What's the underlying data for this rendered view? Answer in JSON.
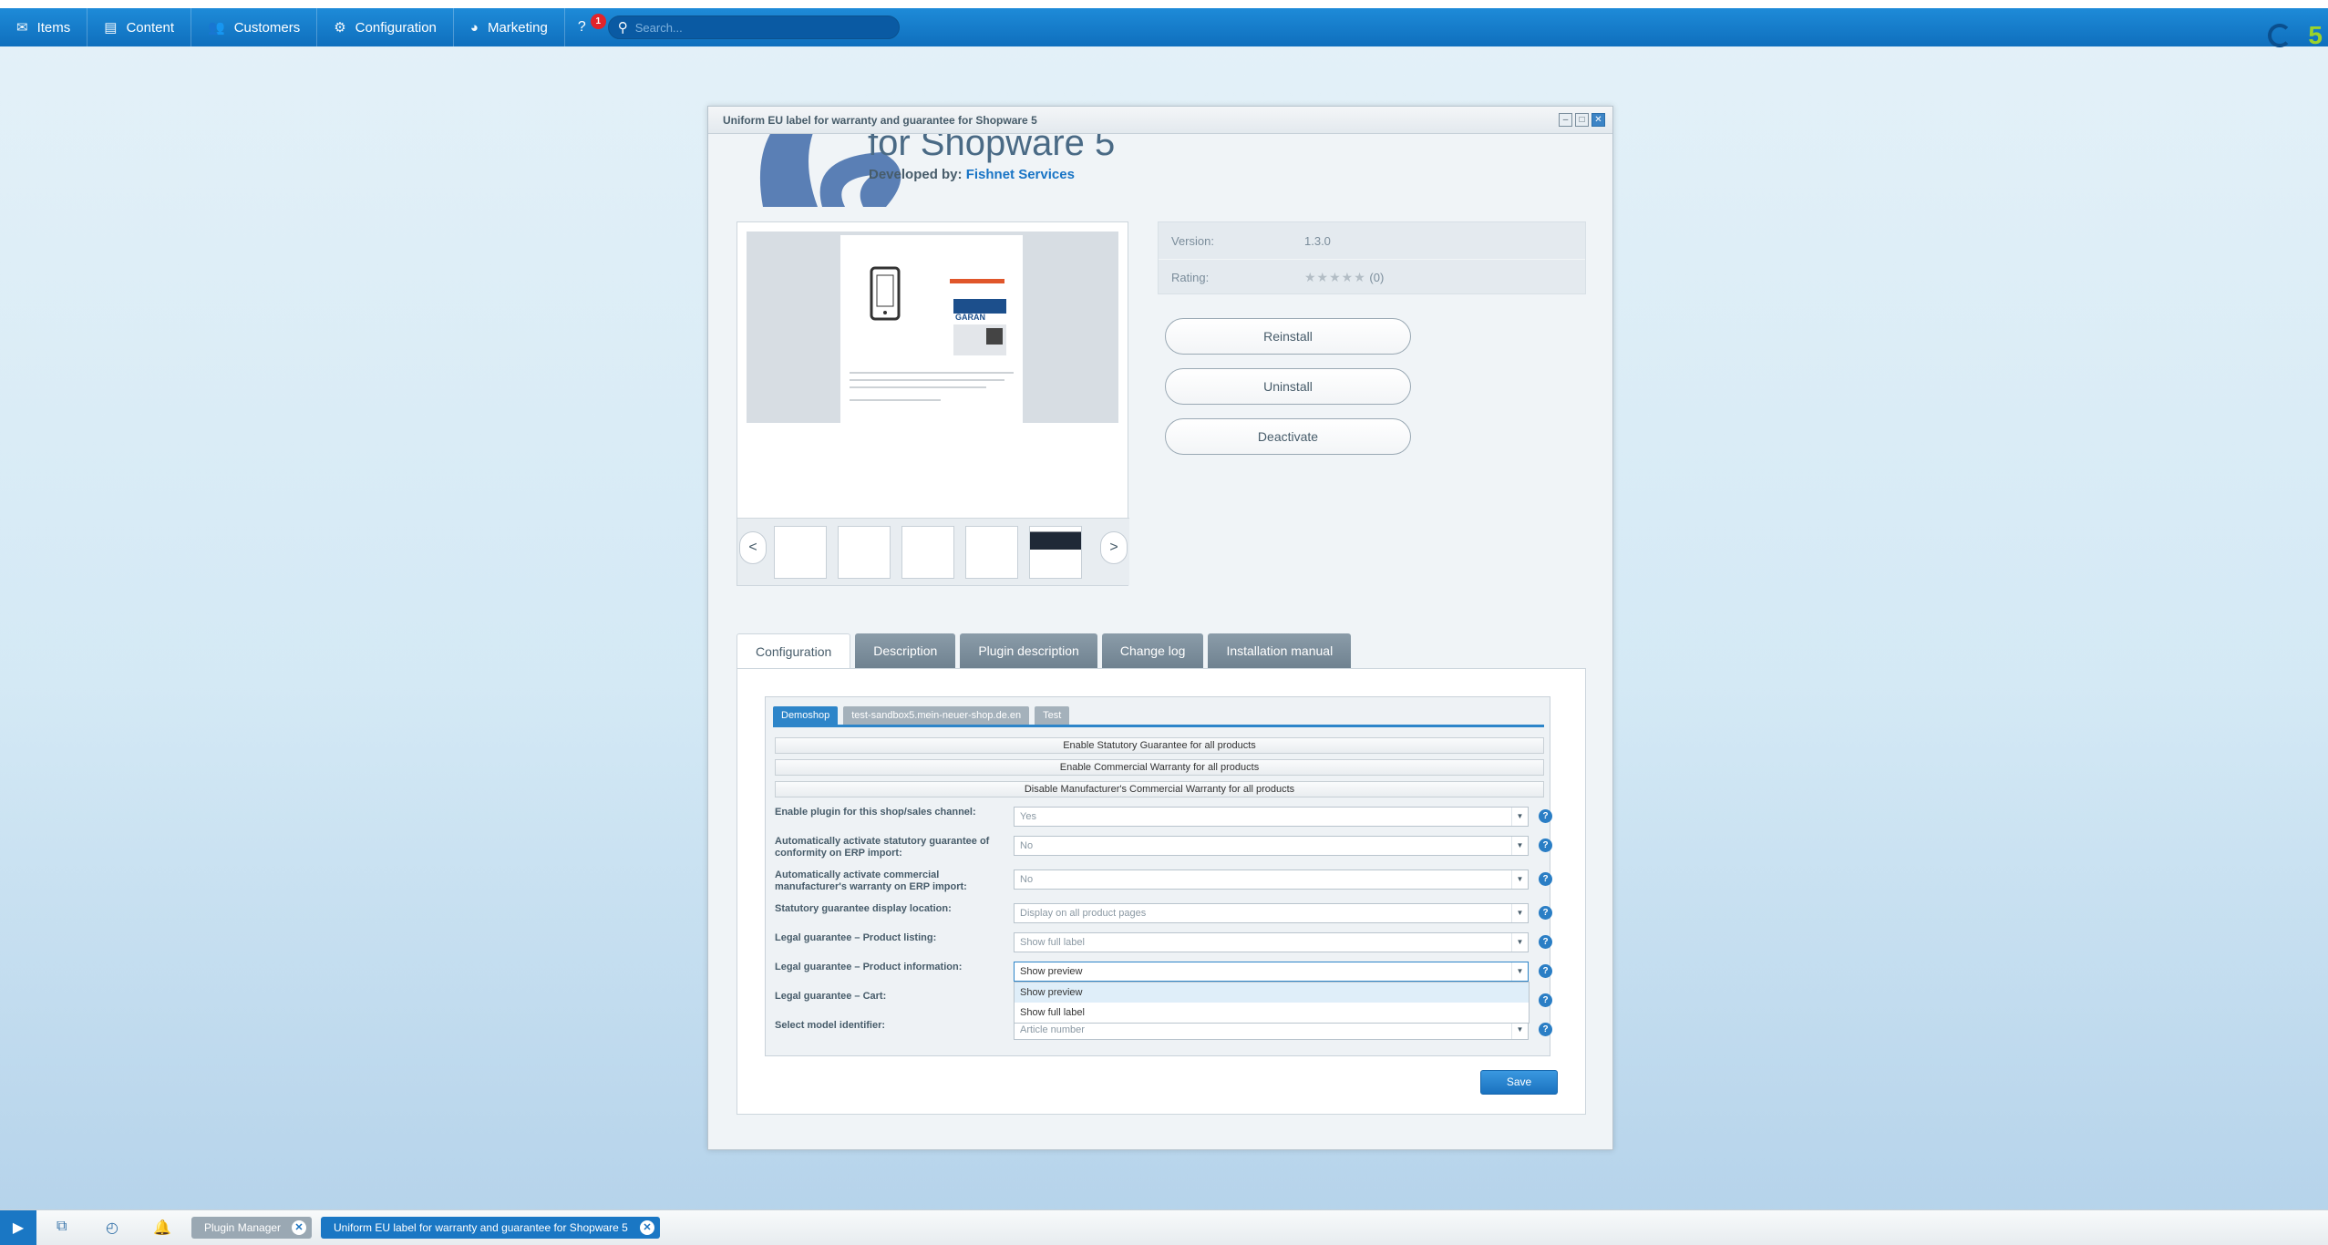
{
  "topbar": {
    "menu": [
      {
        "label": "Items",
        "icon": "items-icon"
      },
      {
        "label": "Content",
        "icon": "content-icon"
      },
      {
        "label": "Customers",
        "icon": "customers-icon"
      },
      {
        "label": "Configuration",
        "icon": "gear-icon"
      },
      {
        "label": "Marketing",
        "icon": "marketing-icon"
      }
    ],
    "help_badge": "1",
    "search_placeholder": "Search..."
  },
  "window": {
    "title": "Uniform EU label for warranty and guarantee for Shopware 5",
    "hero_title": "for Shopware 5",
    "developer_prefix": "Developed by: ",
    "developer_name": "Fishnet Services",
    "gallery": {
      "prev": "<",
      "next": ">",
      "thumb_count": 5
    },
    "info": {
      "version_label": "Version:",
      "version_value": "1.3.0",
      "rating_label": "Rating:",
      "rating_count": "(0)"
    },
    "actions": {
      "reinstall": "Reinstall",
      "uninstall": "Uninstall",
      "deactivate": "Deactivate"
    },
    "tabs": [
      "Configuration",
      "Description",
      "Plugin description",
      "Change log",
      "Installation manual"
    ],
    "shop_tabs": [
      "Demoshop",
      "test-sandbox5.mein-neuer-shop.de.en",
      "Test"
    ],
    "bar_buttons": [
      "Enable Statutory Guarantee for all products",
      "Enable Commercial Warranty for all products",
      "Disable Manufacturer's Commercial Warranty for all products"
    ],
    "fields": [
      {
        "label": "Enable plugin for this shop/sales channel:",
        "value": "Yes"
      },
      {
        "label": "Automatically activate statutory guarantee of conformity on ERP import:",
        "value": "No"
      },
      {
        "label": "Automatically activate commercial manufacturer's warranty on ERP import:",
        "value": "No"
      },
      {
        "label": "Statutory guarantee display location:",
        "value": "Display on all product pages"
      },
      {
        "label": "Legal guarantee – Product listing:",
        "value": "Show full label"
      },
      {
        "label": "Legal guarantee – Product information:",
        "value": "Show preview"
      },
      {
        "label": "Legal guarantee – Cart:",
        "value": ""
      },
      {
        "label": "Select model identifier:",
        "value": "Article number"
      }
    ],
    "dropdown_options": [
      "Show preview",
      "Show full label"
    ],
    "save_label": "Save"
  },
  "taskbar": {
    "tasks": [
      "Plugin Manager",
      "Uniform EU label for warranty and guarantee for Shopware 5"
    ],
    "close_glyph": "✕"
  },
  "colors": {
    "accent": "#1a77c4",
    "topbar": "#1e8bd8",
    "tab_inactive": "#7d8f9c"
  }
}
